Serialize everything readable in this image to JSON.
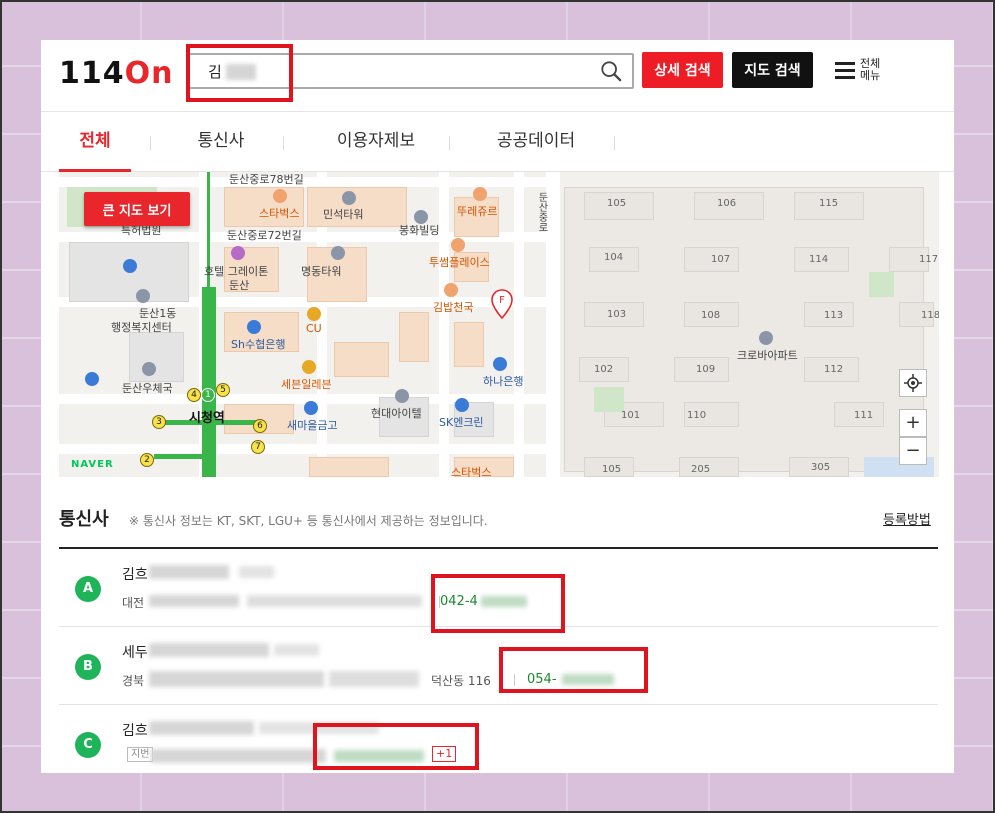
{
  "header": {
    "logo_number": "114",
    "logo_on": "On",
    "search_value": "김",
    "search_placeholder": "",
    "detail_search_label": "상세 검색",
    "map_search_label": "지도 검색",
    "menu_label_line1": "전체",
    "menu_label_line2": "메뉴"
  },
  "tabs": [
    {
      "label": "전체",
      "active": true
    },
    {
      "label": "통신사",
      "active": false
    },
    {
      "label": "이용자제보",
      "active": false
    },
    {
      "label": "공공데이터",
      "active": false
    }
  ],
  "map": {
    "big_map_label": "큰 지도 보기",
    "provider": "NAVER",
    "zoom_in": "+",
    "zoom_out": "−",
    "pois": {
      "p1": "둔산중로78번길",
      "p2": "스타벅스",
      "p3": "민석타워",
      "p4": "뚜레쥬르",
      "p5": "특허법원",
      "p6": "둔산중로72번길",
      "p7": "봉화빌딩",
      "p8": "호텔 그레이톤",
      "p8b": "둔산",
      "p9": "명동타워",
      "p10": "투썸플레이스",
      "p11": "둔산1동",
      "p11b": "행정복지센터",
      "p12": "CU",
      "p13": "김밥천국",
      "p14": "Sh수협은행",
      "p15": "둔산우체국",
      "p16": "세븐일레븐",
      "p17": "하나은행",
      "p18": "시청역",
      "p19": "새마을금고",
      "p20": "현대아이텔",
      "p21": "SK엔크린",
      "p22": "스타벅스",
      "p23": "크로바아파트",
      "p24": "둔산중로"
    },
    "apt_numbers": [
      "105",
      "106",
      "115",
      "104",
      "107",
      "114",
      "117",
      "103",
      "108",
      "113",
      "118",
      "102",
      "109",
      "112",
      "101",
      "110",
      "111",
      "105",
      "205",
      "305"
    ],
    "station_numbers": [
      "1",
      "2",
      "3",
      "4",
      "5",
      "6",
      "7"
    ]
  },
  "results": {
    "section_title": "통신사",
    "section_note": "※ 통신사 정보는 KT, SKT, LGU+ 등 통신사에서 제공하는 정보입니다.",
    "register_link": "등록방법",
    "items": [
      {
        "badge": "A",
        "name": "김흐",
        "address": "대전",
        "phone": "042-4"
      },
      {
        "badge": "B",
        "name": "세두",
        "address": "경북",
        "address_tail": "덕산동 116",
        "phone": "054-"
      },
      {
        "badge": "C",
        "name": "김흐",
        "tag": "지번",
        "extra": "+1"
      }
    ]
  },
  "colors": {
    "brand_red": "#e8262c",
    "highlight_red": "#e0141e",
    "badge_green": "#1fb35a",
    "phone_green": "#1a8a2e"
  }
}
